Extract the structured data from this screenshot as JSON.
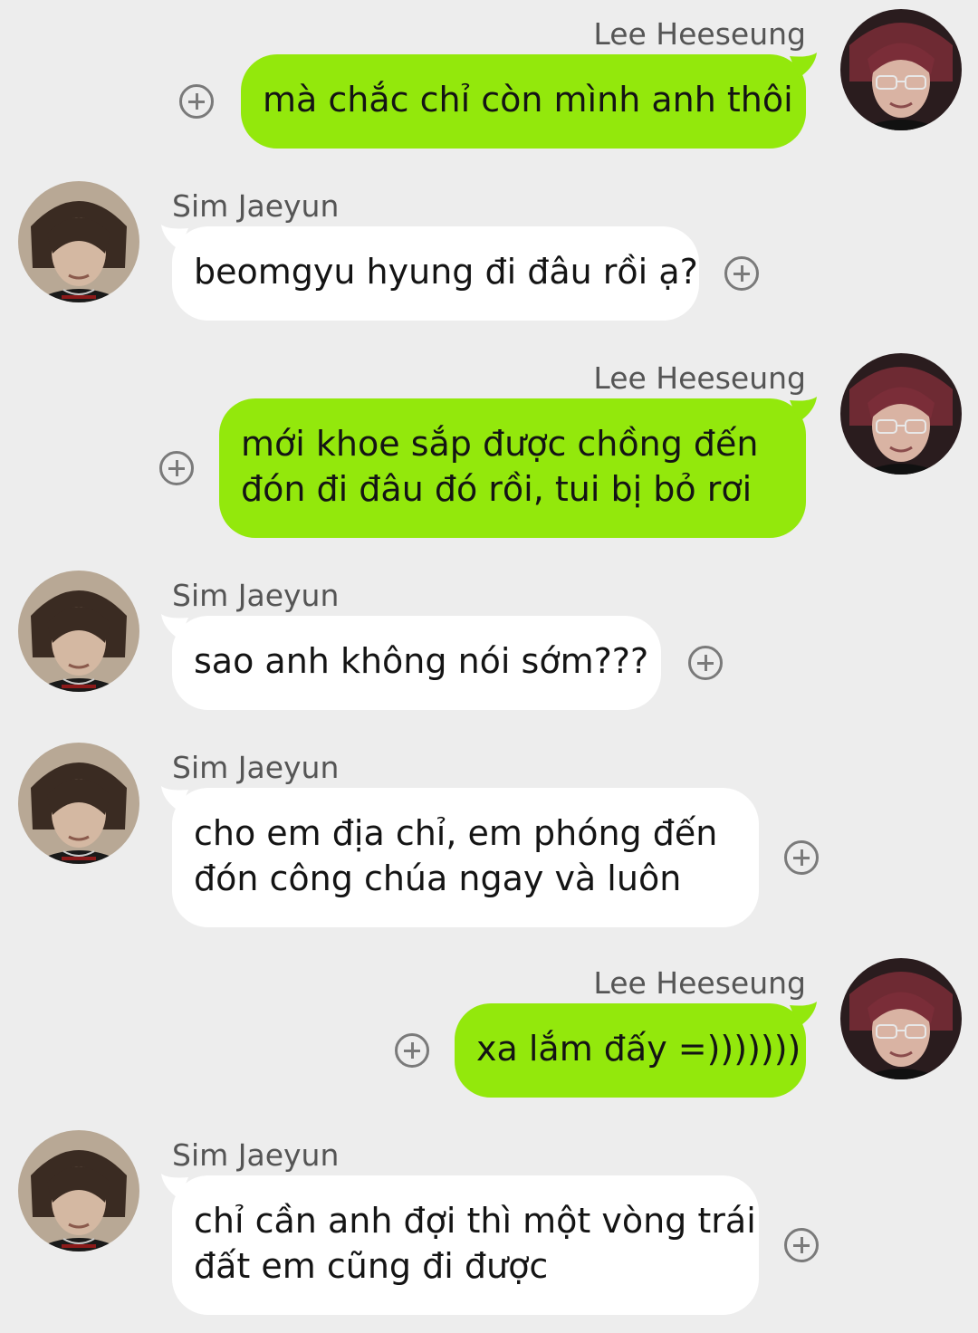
{
  "contacts": {
    "me": {
      "name": "Lee Heeseung",
      "avatar_icon": "heeseung-avatar"
    },
    "them": {
      "name": "Sim Jaeyun",
      "avatar_icon": "jaeyun-avatar"
    }
  },
  "colors": {
    "background": "#ededed",
    "outgoing_bubble": "#93e80c",
    "incoming_bubble": "#ffffff",
    "text": "#141414",
    "sender_name": "#555555"
  },
  "messages": [
    {
      "side": "out",
      "sender": "Lee Heeseung",
      "lines": [
        "mà chắc chỉ còn mình anh thôi"
      ],
      "action_icon": "plus-circle-icon"
    },
    {
      "side": "in",
      "sender": "Sim Jaeyun",
      "lines": [
        "beomgyu hyung đi đâu rồi ạ?"
      ],
      "action_icon": "plus-circle-icon"
    },
    {
      "side": "out",
      "sender": "Lee Heeseung",
      "lines": [
        "mới khoe sắp được chồng đến",
        "đón đi đâu đó rồi, tui bị bỏ rơi"
      ],
      "action_icon": "plus-circle-icon"
    },
    {
      "side": "in",
      "sender": "Sim Jaeyun",
      "lines": [
        "sao anh không nói sớm???"
      ],
      "action_icon": "plus-circle-icon"
    },
    {
      "side": "in",
      "sender": "Sim Jaeyun",
      "lines": [
        "cho em địa chỉ, em phóng đến",
        "đón công chúa ngay và luôn"
      ],
      "action_icon": "plus-circle-icon"
    },
    {
      "side": "out",
      "sender": "Lee Heeseung",
      "lines": [
        "xa lắm đấy =)))))))"
      ],
      "action_icon": "plus-circle-icon"
    },
    {
      "side": "in",
      "sender": "Sim Jaeyun",
      "lines": [
        "chỉ cần anh đợi thì một vòng trái",
        "đất em cũng đi được"
      ],
      "action_icon": "plus-circle-icon"
    }
  ]
}
